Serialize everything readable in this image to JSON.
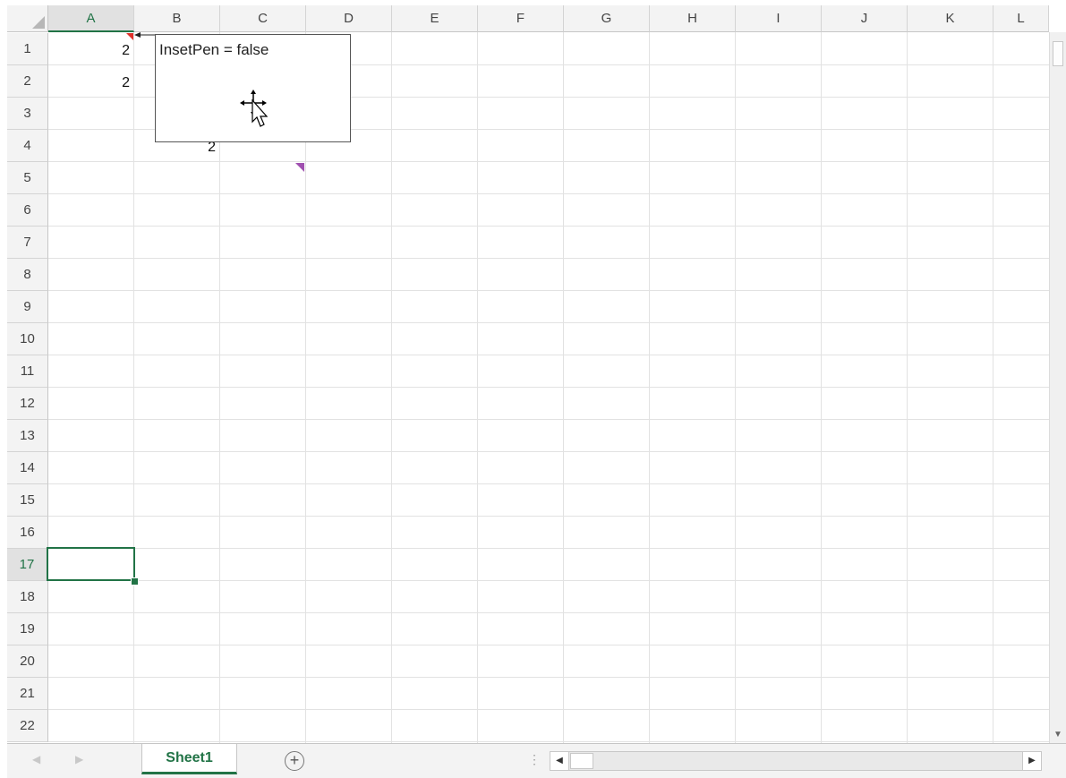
{
  "grid": {
    "columns": [
      "A",
      "B",
      "C",
      "D",
      "E",
      "F",
      "G",
      "H",
      "I",
      "J",
      "K",
      "L"
    ],
    "rows": [
      "1",
      "2",
      "3",
      "4",
      "5",
      "6",
      "7",
      "8",
      "9",
      "10",
      "11",
      "12",
      "13",
      "14",
      "15",
      "16",
      "17",
      "18",
      "19",
      "20",
      "21",
      "22"
    ],
    "active_column": "A",
    "active_row": "17"
  },
  "cells": {
    "A1": "2",
    "A2": "2",
    "B4": "2"
  },
  "comment": {
    "text": "InsetPen = false"
  },
  "tabs": {
    "sheet1": "Sheet1",
    "add_symbol": "+"
  },
  "colors": {
    "accent": "#217346",
    "comment_marker": "#e0302a",
    "comment_marker_alt": "#a050b0"
  },
  "icons": {
    "cursor": "move-cursor-icon",
    "add": "add-sheet-icon"
  }
}
